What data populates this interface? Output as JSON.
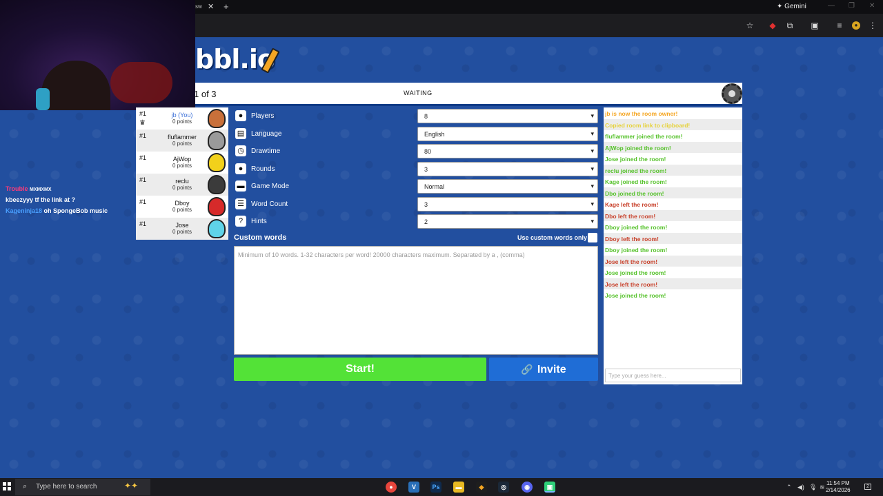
{
  "browser": {
    "tab_fragment": "sw",
    "gemini_label": "Gemini"
  },
  "stream_chat": [
    {
      "user": "Trouble",
      "message": "MXMXMX"
    },
    {
      "user": "kbeezyyy",
      "message": "tf the link at ?"
    },
    {
      "user": "Kageninja18",
      "message": "oh SpongeBob music"
    }
  ],
  "game": {
    "logo_text": "bbl.io",
    "round_text": "1 of 3",
    "status": "WAITING",
    "players": [
      {
        "rank": "#1",
        "name": "jb (You)",
        "points": "0 points",
        "avatar_color": "#c9703a",
        "is_you": true
      },
      {
        "rank": "#1",
        "name": "fluflammer",
        "points": "0 points",
        "avatar_color": "#9a9a9a"
      },
      {
        "rank": "#1",
        "name": "AjWop",
        "points": "0 points",
        "avatar_color": "#f2d11b"
      },
      {
        "rank": "#1",
        "name": "reclu",
        "points": "0 points",
        "avatar_color": "#3b3b3b"
      },
      {
        "rank": "#1",
        "name": "Dboy",
        "points": "0 points",
        "avatar_color": "#d62a2a"
      },
      {
        "rank": "#1",
        "name": "Jose",
        "points": "0 points",
        "avatar_color": "#5fd3e8"
      }
    ],
    "settings": [
      {
        "label": "Players",
        "value": "8",
        "icon": "person-icon"
      },
      {
        "label": "Language",
        "value": "English",
        "icon": "book-icon"
      },
      {
        "label": "Drawtime",
        "value": "80",
        "icon": "clock-icon"
      },
      {
        "label": "Rounds",
        "value": "3",
        "icon": "rounds-icon"
      },
      {
        "label": "Game Mode",
        "value": "Normal",
        "icon": "gamemode-icon"
      },
      {
        "label": "Word Count",
        "value": "3",
        "icon": "list-icon"
      },
      {
        "label": "Hints",
        "value": "2",
        "icon": "question-icon"
      }
    ],
    "custom_words": {
      "title": "Custom words",
      "only_label": "Use custom words only",
      "placeholder": "Minimum of 10 words. 1-32 characters per word! 20000 characters maximum. Separated by a , (comma)"
    },
    "start_label": "Start!",
    "invite_label": "Invite",
    "chat": [
      {
        "text": "jb is now the room owner!",
        "color": "#f5a623"
      },
      {
        "text": "Copied room link to clipboard!",
        "color": "#e6d23a"
      },
      {
        "text": "fluflammer joined the room!",
        "color": "#56c22b"
      },
      {
        "text": "AjWop joined the room!",
        "color": "#56c22b"
      },
      {
        "text": "Jose joined the room!",
        "color": "#56c22b"
      },
      {
        "text": "reclu joined the room!",
        "color": "#56c22b"
      },
      {
        "text": "Kage joined the room!",
        "color": "#56c22b"
      },
      {
        "text": "Dbo joined the room!",
        "color": "#56c22b"
      },
      {
        "text": "Kage left the room!",
        "color": "#c8402a"
      },
      {
        "text": "Dbo left the room!",
        "color": "#c8402a"
      },
      {
        "text": "Dboy joined the room!",
        "color": "#56c22b"
      },
      {
        "text": "Dboy left the room!",
        "color": "#c8402a"
      },
      {
        "text": "Dboy joined the room!",
        "color": "#56c22b"
      },
      {
        "text": "Jose left the room!",
        "color": "#c8402a"
      },
      {
        "text": "Jose joined the room!",
        "color": "#56c22b"
      },
      {
        "text": "Jose left the room!",
        "color": "#c8402a"
      },
      {
        "text": "Jose joined the room!",
        "color": "#56c22b"
      }
    ],
    "guess_placeholder": "Type your guess here..."
  },
  "taskbar": {
    "search_placeholder": "Type here to search",
    "time": "11:54 PM",
    "date": "2/14/2026",
    "notif_count": "2"
  }
}
